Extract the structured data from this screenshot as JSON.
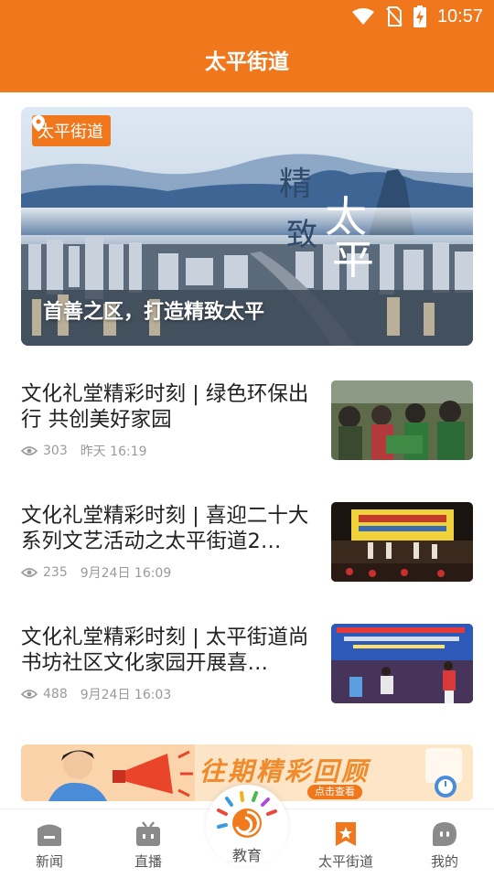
{
  "status_bar": {
    "time": "10:57",
    "icons": [
      "wifi-icon",
      "no-sim-icon",
      "battery-charging-icon"
    ]
  },
  "header": {
    "title": "太平街道"
  },
  "hero": {
    "badge": "太平街道",
    "badge_icon": "location-pin-icon",
    "caption": "首善之区，打造精致太平",
    "art_text": [
      "精",
      "致",
      "太",
      "平"
    ]
  },
  "news": [
    {
      "title": "文化礼堂精彩时刻 | 绿色环保出行  共创美好家园",
      "views": "303",
      "date": "昨天 16:19"
    },
    {
      "title": "文化礼堂精彩时刻 | 喜迎二十大系列文艺活动之太平街道2…",
      "views": "235",
      "date": "9月24日 16:09"
    },
    {
      "title": "文化礼堂精彩时刻 | 太平街道尚书坊社区文化家园开展喜…",
      "views": "488",
      "date": "9月24日 16:03"
    }
  ],
  "promo": {
    "text": "往期精彩回顾",
    "button": "点击查看"
  },
  "bottom_nav": {
    "items": [
      {
        "label": "新闻",
        "icon": "news-icon"
      },
      {
        "label": "直播",
        "icon": "tv-icon"
      },
      {
        "label": "教育",
        "icon": "education-swirl-icon"
      },
      {
        "label": "太平街道",
        "icon": "bookmark-star-icon",
        "active": true
      },
      {
        "label": "我的",
        "icon": "profile-icon"
      }
    ]
  },
  "colors": {
    "brand": "#f0771c",
    "active_nav": "#e3231f"
  }
}
